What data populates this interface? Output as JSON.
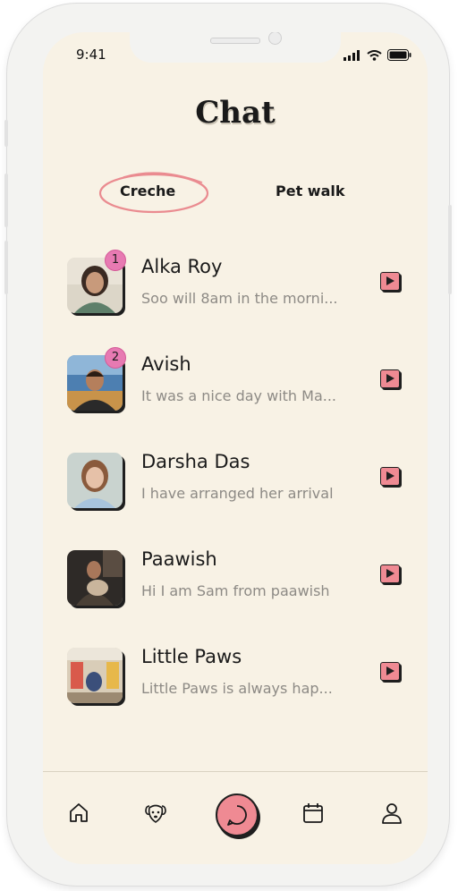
{
  "status_bar": {
    "time": "9:41"
  },
  "header": {
    "title": "Chat"
  },
  "tabs": [
    {
      "label": "Creche",
      "active": true
    },
    {
      "label": "Pet walk",
      "active": false
    }
  ],
  "conversations": [
    {
      "name": "Alka Roy",
      "preview": "Soo will 8am in the morni...",
      "unread": "1"
    },
    {
      "name": "Avish",
      "preview": "It was a nice day with Ma...",
      "unread": "2"
    },
    {
      "name": "Darsha Das",
      "preview": "I have arranged her arrival",
      "unread": ""
    },
    {
      "name": "Paawish",
      "preview": "Hi I am Sam from paawish",
      "unread": ""
    },
    {
      "name": "Little Paws",
      "preview": "Little Paws is always hap...",
      "unread": ""
    }
  ],
  "bottom_nav": {
    "items": [
      "home-icon",
      "dog-icon",
      "chat-icon",
      "calendar-icon",
      "profile-icon"
    ],
    "active": "chat-icon"
  },
  "colors": {
    "background": "#f8f2e5",
    "accent": "#ef8a93",
    "badge": "#e77ab2"
  }
}
